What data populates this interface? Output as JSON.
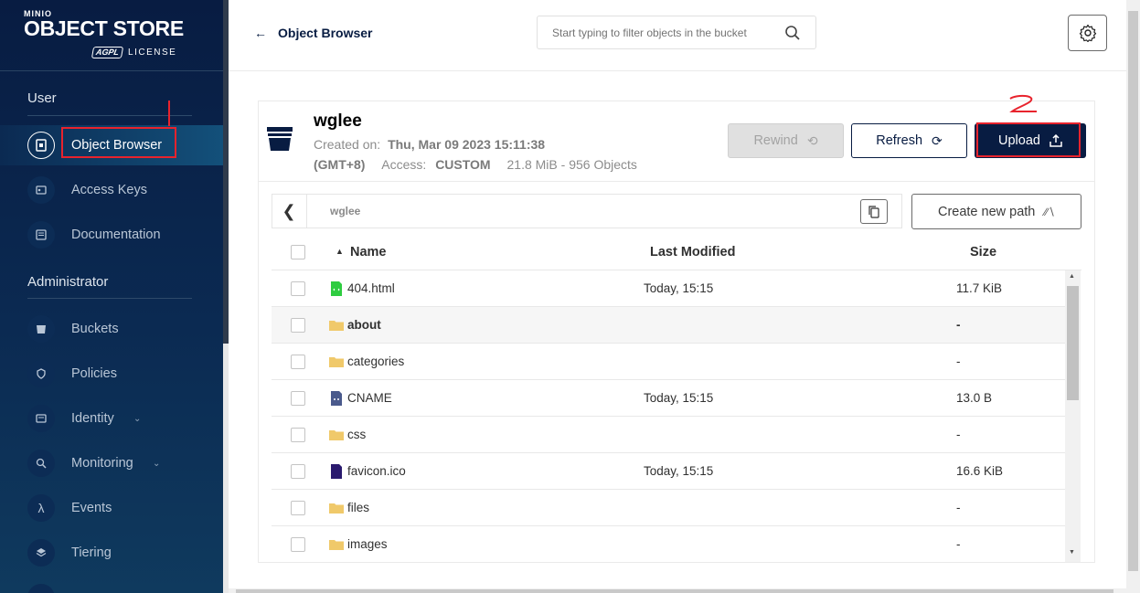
{
  "sidebar": {
    "logo_brand": "MINIO",
    "logo_title": "OBJECT STORE",
    "logo_badge": "AGPL",
    "logo_license": "LICENSE",
    "user_section": "User",
    "admin_section": "Administrator",
    "user_items": [
      {
        "label": "Object Browser",
        "icon": "object-browser-icon",
        "active": true
      },
      {
        "label": "Access Keys",
        "icon": "access-keys-icon"
      },
      {
        "label": "Documentation",
        "icon": "documentation-icon"
      }
    ],
    "admin_items": [
      {
        "label": "Buckets",
        "icon": "buckets-icon"
      },
      {
        "label": "Policies",
        "icon": "policies-icon"
      },
      {
        "label": "Identity",
        "icon": "identity-icon",
        "expandable": true
      },
      {
        "label": "Monitoring",
        "icon": "monitoring-icon",
        "expandable": true
      },
      {
        "label": "Events",
        "icon": "events-icon"
      },
      {
        "label": "Tiering",
        "icon": "tiering-icon"
      }
    ]
  },
  "header": {
    "back_label": "Object Browser",
    "search_placeholder": "Start typing to filter objects in the bucket"
  },
  "bucket": {
    "name": "wglee",
    "created_label": "Created on:",
    "created_value": "Thu, Mar 09 2023 15:11:38",
    "timezone": "(GMT+8)",
    "access_label": "Access:",
    "access_value": "CUSTOM",
    "summary": "21.8 MiB - 956 Objects"
  },
  "actions": {
    "rewind": "Rewind",
    "refresh": "Refresh",
    "upload": "Upload"
  },
  "path": {
    "current": "wglee",
    "create_new_path": "Create new path"
  },
  "table": {
    "col_name": "Name",
    "col_modified": "Last Modified",
    "col_size": "Size",
    "rows": [
      {
        "name": "404.html",
        "modified": "Today, 15:15",
        "size": "11.7 KiB",
        "type": "html"
      },
      {
        "name": "about",
        "modified": "",
        "size": "-",
        "type": "folder",
        "highlight": true
      },
      {
        "name": "categories",
        "modified": "",
        "size": "-",
        "type": "folder"
      },
      {
        "name": "CNAME",
        "modified": "Today, 15:15",
        "size": "13.0 B",
        "type": "file"
      },
      {
        "name": "css",
        "modified": "",
        "size": "-",
        "type": "folder"
      },
      {
        "name": "favicon.ico",
        "modified": "Today, 15:15",
        "size": "16.6 KiB",
        "type": "image"
      },
      {
        "name": "files",
        "modified": "",
        "size": "-",
        "type": "folder"
      },
      {
        "name": "images",
        "modified": "",
        "size": "-",
        "type": "folder"
      }
    ]
  },
  "annotations": {
    "mark_1": "1",
    "mark_2": "2",
    "color": "#e8232d"
  },
  "colors": {
    "brand_navy": "#081c42",
    "brand_red": "#c72e49"
  }
}
